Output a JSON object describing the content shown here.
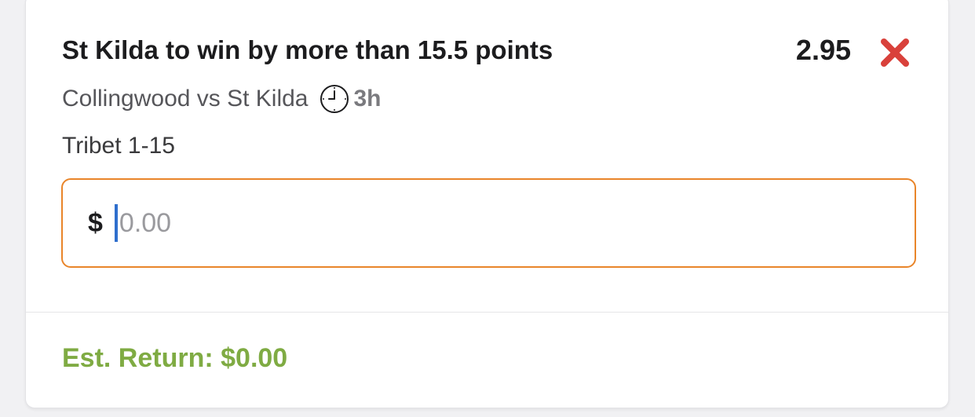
{
  "bet": {
    "selection": "St Kilda to win by more than 15.5 points",
    "odds": "2.95",
    "remove_icon": "close-x-icon",
    "match": "Collingwood vs St Kilda",
    "time_icon": "clock-icon",
    "time_to_start": "3h",
    "market": "Tribet 1-15"
  },
  "stake": {
    "currency_symbol": "$",
    "value": "",
    "placeholder": "0.00"
  },
  "footer": {
    "est_return": "Est. Return: $0.00"
  },
  "colors": {
    "input_border": "#e9852a",
    "remove_icon": "#d9413b",
    "est_return": "#7fab43",
    "caret": "#2f6fcd"
  }
}
